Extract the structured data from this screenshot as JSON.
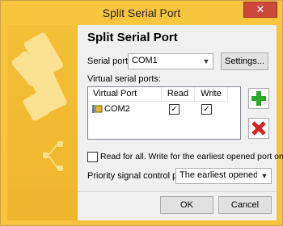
{
  "window": {
    "title": "Split Serial Port",
    "close_glyph": "✕"
  },
  "dialog": {
    "heading": "Split Serial Port",
    "serial_port_label": "Serial port:",
    "serial_port_value": "COM1",
    "settings_button": "Settings...",
    "virtual_ports_label": "Virtual serial ports:",
    "table": {
      "columns": [
        "Virtual Port",
        "Read",
        "Write"
      ],
      "rows": [
        {
          "port": "COM2",
          "read": true,
          "write": true
        }
      ]
    },
    "read_for_all_label": "Read for all. Write for the earliest opened port only.",
    "priority_label": "Priority signal control port:",
    "priority_value": "The earliest opened po",
    "ok_button": "OK",
    "cancel_button": "Cancel",
    "icons": {
      "add": "plus-icon",
      "remove": "x-icon"
    }
  },
  "colors": {
    "accent": "#f6c13d",
    "add_green": "#2aa82a",
    "remove_red": "#d42424"
  }
}
